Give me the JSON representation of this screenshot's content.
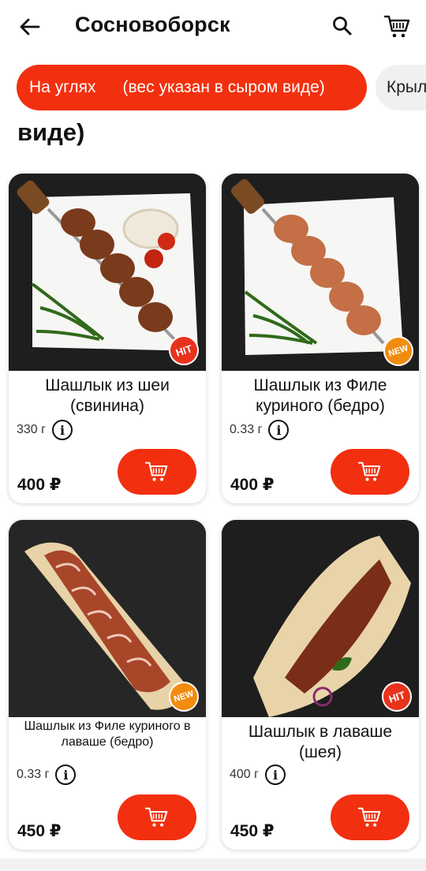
{
  "header": {
    "title": "Сосновоборск",
    "back_icon": "arrow-left-icon",
    "search_icon": "search-icon",
    "cart_icon": "cart-icon"
  },
  "chips": [
    {
      "label_a": "На углях",
      "label_b": "(вес указан в сыром виде)",
      "active": true
    },
    {
      "label": "Крылья",
      "active": false
    }
  ],
  "section": {
    "title": "виде)"
  },
  "colors": {
    "accent": "#f2300f",
    "badge_hit": "#e8331c",
    "badge_new": "#f28c0f"
  },
  "products": [
    {
      "name": "Шашлык из шеи (свинина)",
      "weight": "330 г",
      "price": "400 ₽",
      "badge": "HIT"
    },
    {
      "name": "Шашлык из Филе куриного (бедро)",
      "weight": "0.33 г",
      "price": "400 ₽",
      "badge": "NEW"
    },
    {
      "name": "Шашлык из Филе куриного в лаваше (бедро)",
      "weight": "0.33 г",
      "price": "450 ₽",
      "badge": "NEW"
    },
    {
      "name": "Шашлык в лаваше (шея)",
      "weight": "400 г",
      "price": "450 ₽",
      "badge": "HIT"
    }
  ]
}
